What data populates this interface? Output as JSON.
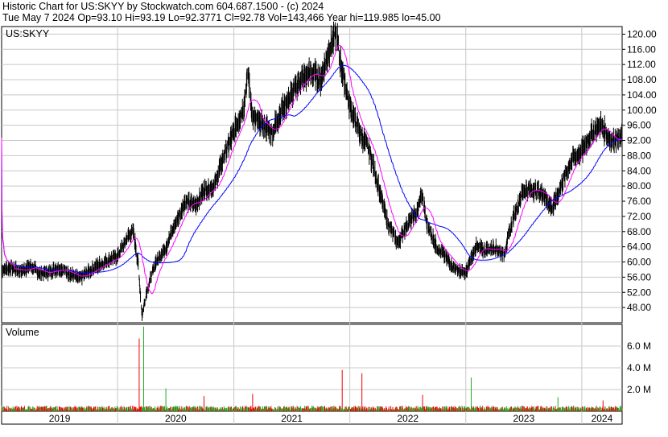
{
  "header": {
    "line1": "Historic Chart for US:SKYY by Stockwatch.com 604.687.1500 - (c) 2024",
    "line2": "Tue May  7 2024   Op=93.10   Hi=93.19   Lo=92.3771   Cl=92.78   Vol=143,466   Year hi=119.985   lo=45.00"
  },
  "chart_data": {
    "type": "line",
    "symbol_label": "US:SKYY",
    "volume_label": "Volume",
    "price_axis": {
      "ylim": [
        44,
        122
      ],
      "ticks": [
        48,
        52,
        56,
        60,
        64,
        68,
        72,
        76,
        80,
        84,
        88,
        92,
        96,
        100,
        104,
        108,
        112,
        116,
        120
      ],
      "tick_labels": [
        "48.00",
        "52.00",
        "56.00",
        "60.00",
        "64.00",
        "68.00",
        "72.00",
        "76.00",
        "80.00",
        "84.00",
        "88.00",
        "92.00",
        "96.00",
        "100.00",
        "104.00",
        "108.00",
        "112.00",
        "116.00",
        "120.00"
      ]
    },
    "volume_axis": {
      "ylim": [
        0,
        8000000
      ],
      "ticks": [
        2000000,
        4000000,
        6000000
      ],
      "tick_labels": [
        "2.0 M",
        "4.0 M",
        "6.0 M"
      ]
    },
    "x_axis": {
      "start": "2019-01-01",
      "end": "2024-05-07",
      "years": [
        {
          "label": "2019",
          "start": "2019-01-01"
        },
        {
          "label": "2020",
          "start": "2020-01-01"
        },
        {
          "label": "2021",
          "start": "2021-01-01"
        },
        {
          "label": "2022",
          "start": "2022-01-01"
        },
        {
          "label": "2023",
          "start": "2023-01-01"
        },
        {
          "label": "2024",
          "start": "2024-01-01"
        }
      ]
    },
    "price_series": [
      [
        "2019-01-02",
        58
      ],
      [
        "2019-02-01",
        58.5
      ],
      [
        "2019-03-01",
        57.5
      ],
      [
        "2019-04-01",
        59
      ],
      [
        "2019-05-01",
        57
      ],
      [
        "2019-06-01",
        57.5
      ],
      [
        "2019-07-01",
        58.5
      ],
      [
        "2019-08-01",
        57
      ],
      [
        "2019-09-01",
        55.5
      ],
      [
        "2019-10-01",
        57.5
      ],
      [
        "2019-11-01",
        59
      ],
      [
        "2019-12-01",
        60.5
      ],
      [
        "2020-01-01",
        61.5
      ],
      [
        "2020-02-01",
        66.5
      ],
      [
        "2020-02-20",
        68
      ],
      [
        "2020-03-05",
        60
      ],
      [
        "2020-03-18",
        46
      ],
      [
        "2020-04-01",
        52
      ],
      [
        "2020-05-01",
        60
      ],
      [
        "2020-06-01",
        64
      ],
      [
        "2020-07-01",
        70
      ],
      [
        "2020-08-01",
        76
      ],
      [
        "2020-09-01",
        75
      ],
      [
        "2020-10-01",
        79
      ],
      [
        "2020-11-01",
        80
      ],
      [
        "2020-12-01",
        88
      ],
      [
        "2021-01-01",
        94
      ],
      [
        "2021-02-01",
        101
      ],
      [
        "2021-02-15",
        110
      ],
      [
        "2021-03-01",
        98
      ],
      [
        "2021-04-01",
        96
      ],
      [
        "2021-05-01",
        94
      ],
      [
        "2021-06-01",
        100
      ],
      [
        "2021-07-01",
        104
      ],
      [
        "2021-08-01",
        108
      ],
      [
        "2021-09-01",
        110
      ],
      [
        "2021-10-01",
        108
      ],
      [
        "2021-11-01",
        117
      ],
      [
        "2021-11-20",
        119.985
      ],
      [
        "2021-12-01",
        113
      ],
      [
        "2022-01-01",
        101
      ],
      [
        "2022-02-01",
        94
      ],
      [
        "2022-03-01",
        90
      ],
      [
        "2022-04-01",
        80
      ],
      [
        "2022-05-01",
        70
      ],
      [
        "2022-06-01",
        65
      ],
      [
        "2022-07-01",
        70
      ],
      [
        "2022-08-01",
        73
      ],
      [
        "2022-08-15",
        78
      ],
      [
        "2022-09-01",
        70
      ],
      [
        "2022-10-01",
        64
      ],
      [
        "2022-11-01",
        61
      ],
      [
        "2022-12-01",
        58
      ],
      [
        "2023-01-01",
        57
      ],
      [
        "2023-02-01",
        64
      ],
      [
        "2023-03-01",
        63
      ],
      [
        "2023-04-01",
        64
      ],
      [
        "2023-05-01",
        62
      ],
      [
        "2023-06-01",
        72
      ],
      [
        "2023-07-01",
        79
      ],
      [
        "2023-08-01",
        79
      ],
      [
        "2023-09-01",
        78
      ],
      [
        "2023-10-01",
        74
      ],
      [
        "2023-11-01",
        81
      ],
      [
        "2023-12-01",
        87
      ],
      [
        "2024-01-01",
        89
      ],
      [
        "2024-02-01",
        94
      ],
      [
        "2024-03-01",
        96
      ],
      [
        "2024-04-01",
        92
      ],
      [
        "2024-05-07",
        92.78
      ]
    ],
    "volume_spikes": [
      [
        "2020-03-10",
        6700000
      ],
      [
        "2020-03-25",
        7800000
      ],
      [
        "2020-06-01",
        2100000
      ],
      [
        "2021-12-10",
        3800000
      ],
      [
        "2022-02-10",
        3500000
      ],
      [
        "2023-01-20",
        3100000
      ],
      [
        "2022-08-20",
        1500000
      ],
      [
        "2021-03-01",
        1600000
      ],
      [
        "2020-10-01",
        1400000
      ],
      [
        "2023-10-20",
        1300000
      ],
      [
        "2024-03-10",
        1000000
      ]
    ],
    "volume_baseline": 500000,
    "colors": {
      "price": "#000000",
      "ma_short": "#ff00ff",
      "ma_long": "#0000ff",
      "vol_up": "#22aa22",
      "vol_down": "#ee0000",
      "grid": "#c8c8c8",
      "frame": "#000000"
    }
  }
}
